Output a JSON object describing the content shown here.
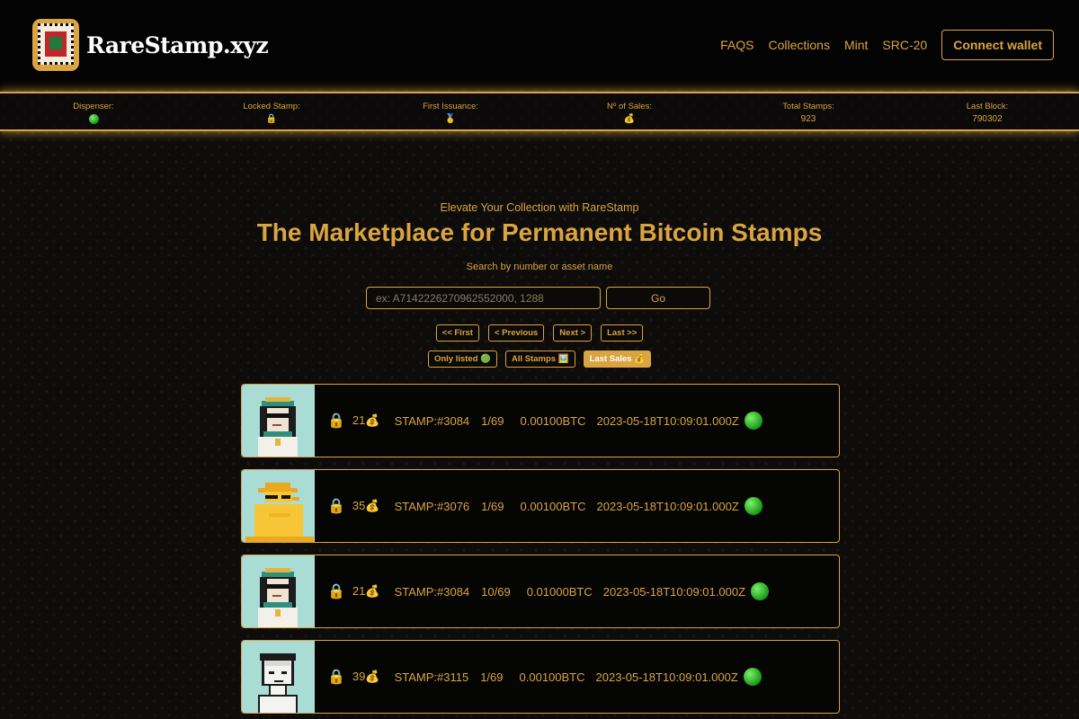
{
  "header": {
    "brand": "RareStamp.xyz",
    "nav": [
      "FAQS",
      "Collections",
      "Mint",
      "SRC-20"
    ],
    "connect_label": "Connect wallet",
    "accent_color": "#d9a441"
  },
  "stats": [
    {
      "label": "Dispenser:",
      "value": "",
      "icon": "green-dot-icon"
    },
    {
      "label": "Locked Stamp:",
      "value": "🔒",
      "icon": "lock-icon"
    },
    {
      "label": "First Issuance:",
      "value": "🥇",
      "icon": "medal-icon"
    },
    {
      "label": "Nº of Sales:",
      "value": "💰",
      "icon": "money-bag-icon"
    },
    {
      "label": "Total Stamps:",
      "value": "923"
    },
    {
      "label": "Last Block:",
      "value": "790302"
    }
  ],
  "hero": {
    "subtitle": "Elevate Your Collection with RareStamp",
    "title": "The Marketplace for Permanent Bitcoin Stamps",
    "search_label": "Search by number or asset name",
    "search_placeholder": "ex: A7142226270962552000, 1288",
    "go_label": "Go"
  },
  "pager": [
    "<< First",
    "< Previous",
    "Next >",
    "Last >>"
  ],
  "filters": [
    {
      "label": "Only listed 🟢",
      "active": false
    },
    {
      "label": "All Stamps 🖼️",
      "active": false
    },
    {
      "label": "Last Sales 💰",
      "active": true
    }
  ],
  "sales": [
    {
      "lock": "🔒",
      "sales": "21💰",
      "stamp": "STAMP:#3084",
      "edition": "1/69",
      "price": "0.00100BTC",
      "date": "2023-05-18T10:09:01.000Z",
      "thumb": "pharaoh-punk"
    },
    {
      "lock": "🔒",
      "sales": "35💰",
      "stamp": "STAMP:#3076",
      "edition": "1/69",
      "price": "0.00100BTC",
      "date": "2023-05-18T10:09:01.000Z",
      "thumb": "yellow-duck"
    },
    {
      "lock": "🔒",
      "sales": "21💰",
      "stamp": "STAMP:#3084",
      "edition": "10/69",
      "price": "0.01000BTC",
      "date": "2023-05-18T10:09:01.000Z",
      "thumb": "pharaoh-punk"
    },
    {
      "lock": "🔒",
      "sales": "39💰",
      "stamp": "STAMP:#3115",
      "edition": "1/69",
      "price": "0.00100BTC",
      "date": "2023-05-18T10:09:01.000Z",
      "thumb": "white-alien"
    }
  ]
}
